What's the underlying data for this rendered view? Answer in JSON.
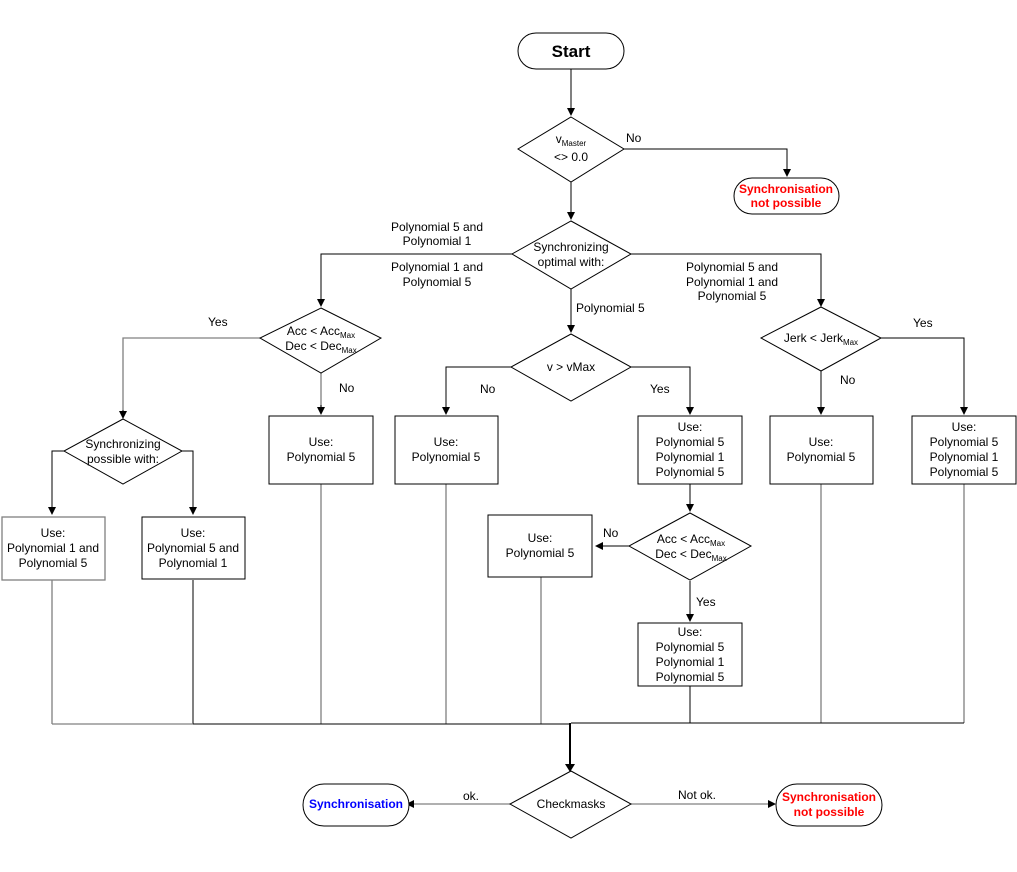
{
  "colors": {
    "outline": "#000000",
    "connector_gray": "#808080",
    "error_text": "#ff0000",
    "success_text": "#0000ff"
  },
  "start": {
    "label": "Start"
  },
  "decision_vmaster": {
    "line1_base": "v",
    "line1_sub": "Master",
    "line2": "<> 0.0",
    "no_label": "No"
  },
  "terminal_not_possible_top": {
    "line1": "Synchronisation",
    "line2": "not possible"
  },
  "decision_optimal": {
    "line1": "Synchronizing",
    "line2": "optimal with:",
    "left_upper_label": [
      "Polynomial 5 and",
      "Polynomial 1"
    ],
    "left_lower_label": [
      "Polynomial 1 and",
      "Polynomial 5"
    ],
    "down_label": "Polynomial 5",
    "right_label": [
      "Polynomial 5 and",
      "Polynomial 1 and",
      "Polynomial 5"
    ]
  },
  "decision_acc_left": {
    "line1_base": "Acc < Acc",
    "line1_sub": "Max",
    "line2_base": "Dec < Dec",
    "line2_sub": "Max",
    "yes_label": "Yes",
    "no_label": "No"
  },
  "decision_possible": {
    "line1": "Synchronizing",
    "line2": "possible with:"
  },
  "box_p1_p5": {
    "lines": [
      "Use:",
      "Polynomial 1 and",
      "Polynomial 5"
    ]
  },
  "box_p5_p1": {
    "lines": [
      "Use:",
      "Polynomial 5 and",
      "Polynomial 1"
    ]
  },
  "box_left_no_p5": {
    "lines": [
      "Use:",
      "Polynomial 5"
    ]
  },
  "decision_vmax": {
    "label": "v > vMax",
    "no_label": "No",
    "yes_label": "Yes"
  },
  "box_vmax_no_p5": {
    "lines": [
      "Use:",
      "Polynomial 5"
    ]
  },
  "box_vmax_yes_p515": {
    "lines": [
      "Use:",
      "Polynomial 5",
      "Polynomial 1",
      "Polynomial 5"
    ]
  },
  "decision_acc_mid": {
    "line1_base": "Acc < Acc",
    "line1_sub": "Max",
    "line2_base": "Dec < Dec",
    "line2_sub": "Max",
    "no_label": "No",
    "yes_label": "Yes"
  },
  "box_acc_mid_no_p5": {
    "lines": [
      "Use:",
      "Polynomial 5"
    ]
  },
  "box_acc_mid_yes_p515": {
    "lines": [
      "Use:",
      "Polynomial 5",
      "Polynomial 1",
      "Polynomial 5"
    ]
  },
  "decision_jerk": {
    "line1_base": "Jerk < Jerk",
    "line1_sub": "Max",
    "no_label": "No",
    "yes_label": "Yes"
  },
  "box_jerk_no_p5": {
    "lines": [
      "Use:",
      "Polynomial 5"
    ]
  },
  "box_jerk_yes_p515": {
    "lines": [
      "Use:",
      "Polynomial 5",
      "Polynomial 1",
      "Polynomial 5"
    ]
  },
  "decision_checkmasks": {
    "label": "Checkmasks",
    "ok_label": "ok.",
    "not_ok_label": "Not ok."
  },
  "terminal_synchronisation": {
    "label": "Synchronisation"
  },
  "terminal_not_possible_bottom": {
    "line1": "Synchronisation",
    "line2": "not possible"
  }
}
